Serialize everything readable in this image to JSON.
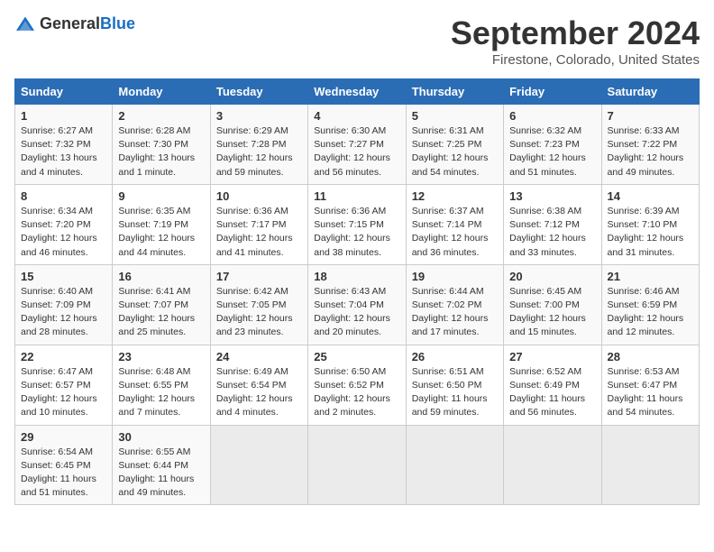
{
  "header": {
    "logo_general": "General",
    "logo_blue": "Blue",
    "month_year": "September 2024",
    "location": "Firestone, Colorado, United States"
  },
  "weekdays": [
    "Sunday",
    "Monday",
    "Tuesday",
    "Wednesday",
    "Thursday",
    "Friday",
    "Saturday"
  ],
  "weeks": [
    [
      {
        "day": "1",
        "sunrise": "6:27 AM",
        "sunset": "7:32 PM",
        "daylight": "13 hours and 4 minutes."
      },
      {
        "day": "2",
        "sunrise": "6:28 AM",
        "sunset": "7:30 PM",
        "daylight": "13 hours and 1 minute."
      },
      {
        "day": "3",
        "sunrise": "6:29 AM",
        "sunset": "7:28 PM",
        "daylight": "12 hours and 59 minutes."
      },
      {
        "day": "4",
        "sunrise": "6:30 AM",
        "sunset": "7:27 PM",
        "daylight": "12 hours and 56 minutes."
      },
      {
        "day": "5",
        "sunrise": "6:31 AM",
        "sunset": "7:25 PM",
        "daylight": "12 hours and 54 minutes."
      },
      {
        "day": "6",
        "sunrise": "6:32 AM",
        "sunset": "7:23 PM",
        "daylight": "12 hours and 51 minutes."
      },
      {
        "day": "7",
        "sunrise": "6:33 AM",
        "sunset": "7:22 PM",
        "daylight": "12 hours and 49 minutes."
      }
    ],
    [
      {
        "day": "8",
        "sunrise": "6:34 AM",
        "sunset": "7:20 PM",
        "daylight": "12 hours and 46 minutes."
      },
      {
        "day": "9",
        "sunrise": "6:35 AM",
        "sunset": "7:19 PM",
        "daylight": "12 hours and 44 minutes."
      },
      {
        "day": "10",
        "sunrise": "6:36 AM",
        "sunset": "7:17 PM",
        "daylight": "12 hours and 41 minutes."
      },
      {
        "day": "11",
        "sunrise": "6:36 AM",
        "sunset": "7:15 PM",
        "daylight": "12 hours and 38 minutes."
      },
      {
        "day": "12",
        "sunrise": "6:37 AM",
        "sunset": "7:14 PM",
        "daylight": "12 hours and 36 minutes."
      },
      {
        "day": "13",
        "sunrise": "6:38 AM",
        "sunset": "7:12 PM",
        "daylight": "12 hours and 33 minutes."
      },
      {
        "day": "14",
        "sunrise": "6:39 AM",
        "sunset": "7:10 PM",
        "daylight": "12 hours and 31 minutes."
      }
    ],
    [
      {
        "day": "15",
        "sunrise": "6:40 AM",
        "sunset": "7:09 PM",
        "daylight": "12 hours and 28 minutes."
      },
      {
        "day": "16",
        "sunrise": "6:41 AM",
        "sunset": "7:07 PM",
        "daylight": "12 hours and 25 minutes."
      },
      {
        "day": "17",
        "sunrise": "6:42 AM",
        "sunset": "7:05 PM",
        "daylight": "12 hours and 23 minutes."
      },
      {
        "day": "18",
        "sunrise": "6:43 AM",
        "sunset": "7:04 PM",
        "daylight": "12 hours and 20 minutes."
      },
      {
        "day": "19",
        "sunrise": "6:44 AM",
        "sunset": "7:02 PM",
        "daylight": "12 hours and 17 minutes."
      },
      {
        "day": "20",
        "sunrise": "6:45 AM",
        "sunset": "7:00 PM",
        "daylight": "12 hours and 15 minutes."
      },
      {
        "day": "21",
        "sunrise": "6:46 AM",
        "sunset": "6:59 PM",
        "daylight": "12 hours and 12 minutes."
      }
    ],
    [
      {
        "day": "22",
        "sunrise": "6:47 AM",
        "sunset": "6:57 PM",
        "daylight": "12 hours and 10 minutes."
      },
      {
        "day": "23",
        "sunrise": "6:48 AM",
        "sunset": "6:55 PM",
        "daylight": "12 hours and 7 minutes."
      },
      {
        "day": "24",
        "sunrise": "6:49 AM",
        "sunset": "6:54 PM",
        "daylight": "12 hours and 4 minutes."
      },
      {
        "day": "25",
        "sunrise": "6:50 AM",
        "sunset": "6:52 PM",
        "daylight": "12 hours and 2 minutes."
      },
      {
        "day": "26",
        "sunrise": "6:51 AM",
        "sunset": "6:50 PM",
        "daylight": "11 hours and 59 minutes."
      },
      {
        "day": "27",
        "sunrise": "6:52 AM",
        "sunset": "6:49 PM",
        "daylight": "11 hours and 56 minutes."
      },
      {
        "day": "28",
        "sunrise": "6:53 AM",
        "sunset": "6:47 PM",
        "daylight": "11 hours and 54 minutes."
      }
    ],
    [
      {
        "day": "29",
        "sunrise": "6:54 AM",
        "sunset": "6:45 PM",
        "daylight": "11 hours and 51 minutes."
      },
      {
        "day": "30",
        "sunrise": "6:55 AM",
        "sunset": "6:44 PM",
        "daylight": "11 hours and 49 minutes."
      },
      null,
      null,
      null,
      null,
      null
    ]
  ],
  "labels": {
    "sunrise": "Sunrise:",
    "sunset": "Sunset:",
    "daylight": "Daylight:"
  }
}
